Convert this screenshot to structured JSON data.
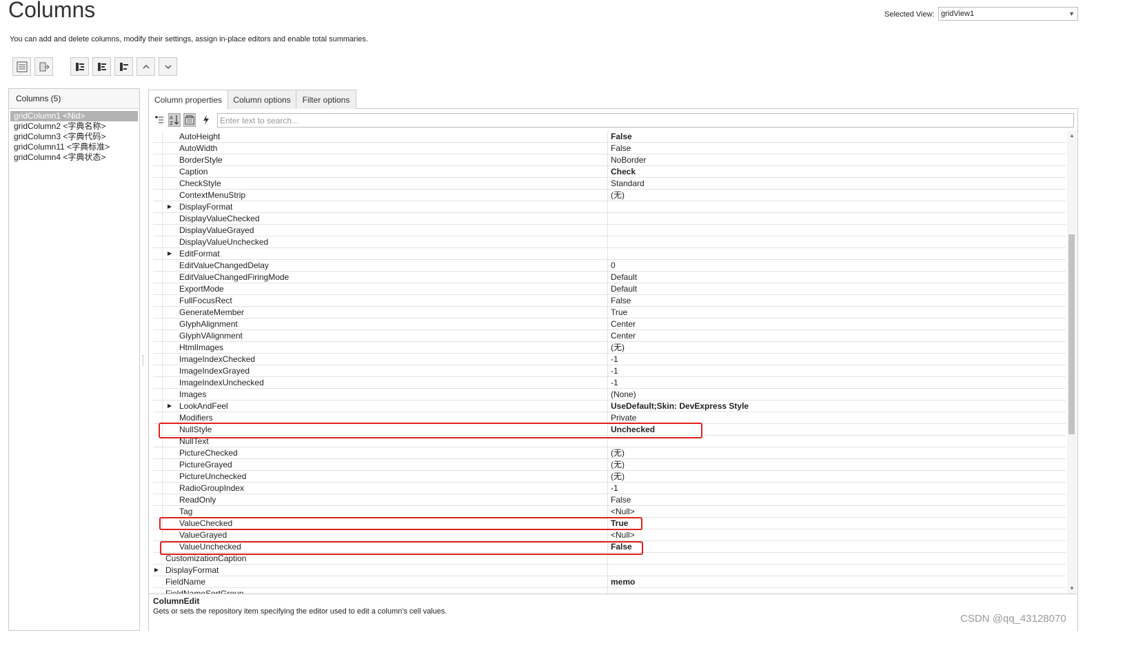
{
  "header": {
    "title": "Columns",
    "description": "You can add and delete columns, modify their settings, assign in-place editors and enable total summaries.",
    "selected_view_label": "Selected View:",
    "selected_view_value": "gridView1"
  },
  "toolbar": {
    "buttons": [
      "show-designer-icon",
      "retrieve-fields-icon",
      "add-column-icon",
      "insert-column-icon",
      "remove-column-icon",
      "move-up-icon",
      "move-down-icon"
    ]
  },
  "columns_panel": {
    "header": "Columns (5)",
    "items": [
      "gridColumn1 <Nid>",
      "gridColumn2 <字典名称>",
      "gridColumn3 <字典代码>",
      "gridColumn11 <字典标准>",
      "gridColumn4 <字典状态>"
    ],
    "selected_index": 0
  },
  "tabs": [
    "Column properties",
    "Column options",
    "Filter options"
  ],
  "active_tab": 0,
  "search": {
    "placeholder": "Enter text to search..."
  },
  "properties": [
    {
      "name": "AutoHeight",
      "value": "False",
      "bold": true,
      "nested": true
    },
    {
      "name": "AutoWidth",
      "value": "False",
      "nested": true
    },
    {
      "name": "BorderStyle",
      "value": "NoBorder",
      "nested": true
    },
    {
      "name": "Caption",
      "value": "Check",
      "bold": true,
      "nested": true
    },
    {
      "name": "CheckStyle",
      "value": "Standard",
      "nested": true
    },
    {
      "name": "ContextMenuStrip",
      "value": "(无)",
      "nested": true
    },
    {
      "name": "DisplayFormat",
      "value": "",
      "nested": true,
      "expandable": true
    },
    {
      "name": "DisplayValueChecked",
      "value": "",
      "nested": true
    },
    {
      "name": "DisplayValueGrayed",
      "value": "",
      "nested": true
    },
    {
      "name": "DisplayValueUnchecked",
      "value": "",
      "nested": true
    },
    {
      "name": "EditFormat",
      "value": "",
      "nested": true,
      "expandable": true
    },
    {
      "name": "EditValueChangedDelay",
      "value": "0",
      "nested": true
    },
    {
      "name": "EditValueChangedFiringMode",
      "value": "Default",
      "nested": true
    },
    {
      "name": "ExportMode",
      "value": "Default",
      "nested": true
    },
    {
      "name": "FullFocusRect",
      "value": "False",
      "nested": true
    },
    {
      "name": "GenerateMember",
      "value": "True",
      "nested": true
    },
    {
      "name": "GlyphAlignment",
      "value": "Center",
      "nested": true
    },
    {
      "name": "GlyphVAlignment",
      "value": "Center",
      "nested": true
    },
    {
      "name": "HtmlImages",
      "value": "(无)",
      "nested": true
    },
    {
      "name": "ImageIndexChecked",
      "value": "-1",
      "nested": true
    },
    {
      "name": "ImageIndexGrayed",
      "value": "-1",
      "nested": true
    },
    {
      "name": "ImageIndexUnchecked",
      "value": "-1",
      "nested": true
    },
    {
      "name": "Images",
      "value": "(None)",
      "nested": true
    },
    {
      "name": "LookAndFeel",
      "value": "UseDefault;Skin: DevExpress Style",
      "bold": true,
      "nested": true,
      "expandable": true
    },
    {
      "name": "Modifiers",
      "value": "Private",
      "nested": true
    },
    {
      "name": "NullStyle",
      "value": "Unchecked",
      "bold": true,
      "nested": true
    },
    {
      "name": "NullText",
      "value": "",
      "nested": true
    },
    {
      "name": "PictureChecked",
      "value": "(无)",
      "nested": true
    },
    {
      "name": "PictureGrayed",
      "value": "(无)",
      "nested": true
    },
    {
      "name": "PictureUnchecked",
      "value": "(无)",
      "nested": true
    },
    {
      "name": "RadioGroupIndex",
      "value": "-1",
      "nested": true
    },
    {
      "name": "ReadOnly",
      "value": "False",
      "nested": true
    },
    {
      "name": "Tag",
      "value": "<Null>",
      "nested": true
    },
    {
      "name": "ValueChecked",
      "value": "True",
      "bold": true,
      "nested": true
    },
    {
      "name": "ValueGrayed",
      "value": "<Null>",
      "nested": true
    },
    {
      "name": "ValueUnchecked",
      "value": "False",
      "bold": true,
      "nested": true
    },
    {
      "name": "CustomizationCaption",
      "value": "",
      "nested": false
    },
    {
      "name": "DisplayFormat",
      "value": "",
      "nested": false,
      "expandable": true
    },
    {
      "name": "FieldName",
      "value": "memo",
      "bold": true,
      "nested": false
    },
    {
      "name": "FieldNameSortGroup",
      "value": "",
      "nested": false
    }
  ],
  "description": {
    "title": "ColumnEdit",
    "text": "Gets or sets the repository item specifying the editor used to edit a column's cell values."
  },
  "watermark": "CSDN @qq_43128070",
  "highlight_color": "#e0201c"
}
